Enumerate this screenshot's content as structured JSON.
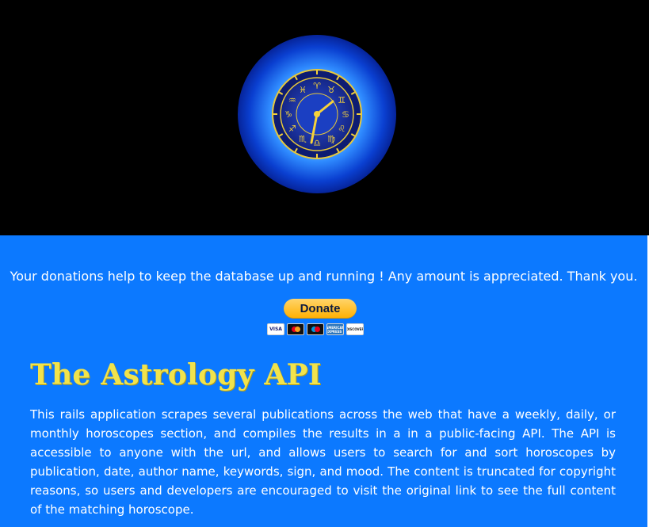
{
  "hero": {
    "logo_icon": "zodiac-clock-icon",
    "zodiac_glyphs": [
      "♈",
      "♉",
      "♊",
      "♋",
      "♌",
      "♍",
      "♎",
      "♏",
      "♐",
      "♑",
      "♒",
      "♓"
    ],
    "colors": {
      "background": "#000000",
      "glow": "#1e6bff",
      "face": "#1a2a8a",
      "gold": "#f6d23a"
    }
  },
  "donate": {
    "message": "Your donations help to keep the database up and running ! Any amount is appreciated. Thank you.",
    "button_label": "Donate",
    "cards": [
      {
        "name": "visa-card-icon",
        "label": "VISA"
      },
      {
        "name": "mastercard-icon",
        "label": ""
      },
      {
        "name": "maestro-card-icon",
        "label": ""
      },
      {
        "name": "amex-card-icon",
        "label": "AMERICAN EXPRESS"
      },
      {
        "name": "discover-card-icon",
        "label": "DISCOVER"
      }
    ]
  },
  "main": {
    "title": "The Astrology API",
    "description": "This rails application scrapes several publications across the web that have a weekly, daily, or monthly horoscopes section, and compiles the results in a in a public-facing API. The API is accessible to anyone with the url, and allows users to search for and sort horoscopes by publication, date, author name, keywords, sign, and mood. The content is truncated for copyright reasons, so users and developers are encouraged to visit the original link to see the full content of the matching horoscope."
  },
  "colors": {
    "content_background": "#0c79ff",
    "title_color": "#f1e34c",
    "text_color": "#ffffff",
    "button_color": "#ffc439"
  }
}
